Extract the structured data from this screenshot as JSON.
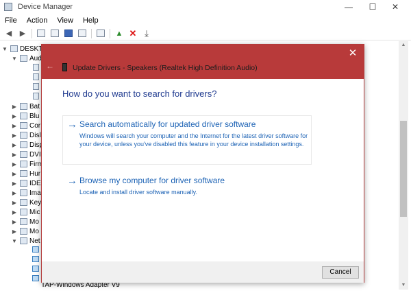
{
  "window": {
    "title": "Device Manager",
    "minimize": "—",
    "maximize": "☐",
    "close": "✕"
  },
  "menu": [
    "File",
    "Action",
    "View",
    "Help"
  ],
  "tree": {
    "computer": "DESKTO",
    "audio": "Aud",
    "categories": [
      "Bat",
      "Blu",
      "Cor",
      "Disl",
      "Disp",
      "DVI",
      "Firm",
      "Hur",
      "IDE",
      "Ima",
      "Key",
      "Mic",
      "Mo",
      "Mo",
      "Net"
    ],
    "tap_adapter": "TAP-Windows Adapter V9"
  },
  "dialog": {
    "close": "✕",
    "back": "←",
    "title": "Update Drivers - Speakers (Realtek High Definition Audio)",
    "question": "How do you want to search for drivers?",
    "options": [
      {
        "arrow": "→",
        "title": "Search automatically for updated driver software",
        "description": "Windows will search your computer and the Internet for the latest driver software for your device, unless you've disabled this feature in your device installation settings."
      },
      {
        "arrow": "→",
        "title": "Browse my computer for driver software",
        "description": "Locate and install driver software manually."
      }
    ],
    "cancel": "Cancel"
  },
  "colors": {
    "dialog_header": "#b83a3a",
    "link_blue": "#1d63b5",
    "question_blue": "#1f3a8f"
  }
}
